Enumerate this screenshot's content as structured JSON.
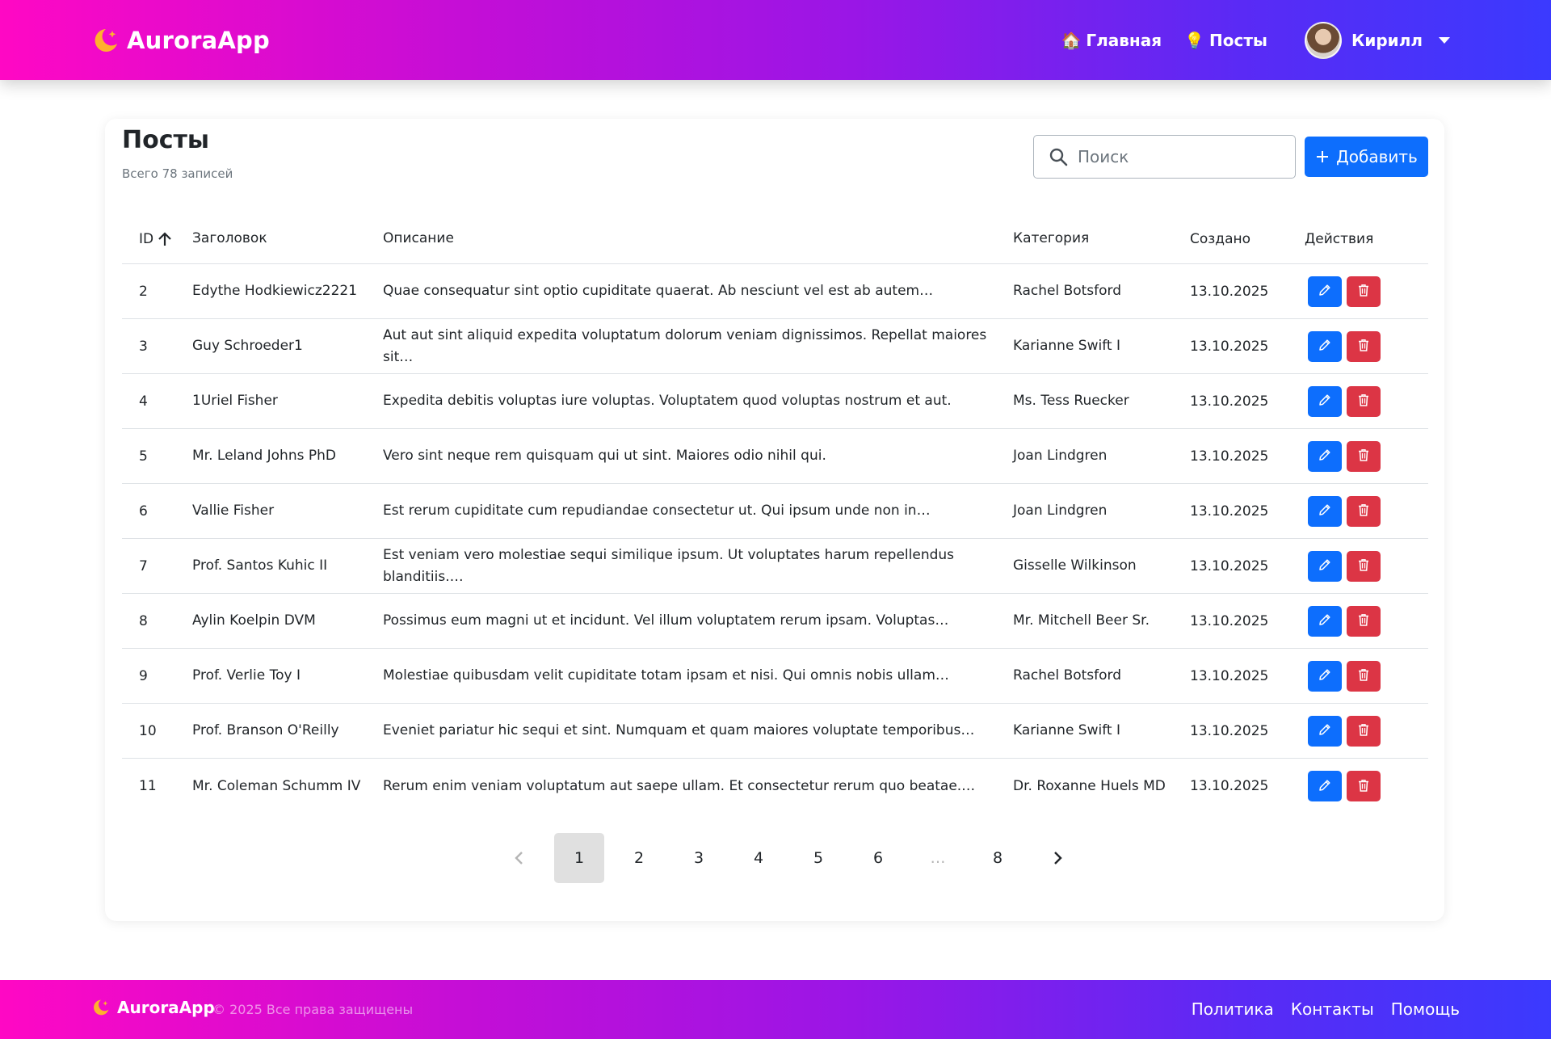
{
  "navbar": {
    "brand": "AuroraApp",
    "links": [
      {
        "emoji": "🏠",
        "label": "Главная"
      },
      {
        "emoji": "💡",
        "label": "Посты"
      }
    ],
    "user": {
      "name": "Кирилл"
    }
  },
  "page": {
    "title": "Посты",
    "subtitle": "Всего 78 записей",
    "search_placeholder": "Поиск",
    "add_label": "Добавить"
  },
  "table": {
    "headers": {
      "id": "ID",
      "title": "Заголовок",
      "description": "Описание",
      "category": "Категория",
      "created": "Создано",
      "actions": "Действия"
    },
    "rows": [
      {
        "id": "2",
        "title": "Edythe Hodkiewicz2221",
        "description": "Quae consequatur sint optio cupiditate quaerat. Ab nesciunt vel est ab autem…",
        "category": "Rachel Botsford",
        "created": "13.10.2025"
      },
      {
        "id": "3",
        "title": "Guy Schroeder1",
        "description": "Aut aut sint aliquid expedita voluptatum dolorum veniam dignissimos. Repellat maiores sit…",
        "category": "Karianne Swift I",
        "created": "13.10.2025"
      },
      {
        "id": "4",
        "title": "1Uriel Fisher",
        "description": "Expedita debitis voluptas iure voluptas. Voluptatem quod voluptas nostrum et aut.",
        "category": "Ms. Tess Ruecker",
        "created": "13.10.2025"
      },
      {
        "id": "5",
        "title": "Mr. Leland Johns PhD",
        "description": "Vero sint neque rem quisquam qui ut sint. Maiores odio nihil qui.",
        "category": "Joan Lindgren",
        "created": "13.10.2025"
      },
      {
        "id": "6",
        "title": "Vallie Fisher",
        "description": "Est rerum cupiditate cum repudiandae consectetur ut. Qui ipsum unde non in…",
        "category": "Joan Lindgren",
        "created": "13.10.2025"
      },
      {
        "id": "7",
        "title": "Prof. Santos Kuhic II",
        "description": "Est veniam vero molestiae sequi similique ipsum. Ut voluptates harum repellendus blanditiis.…",
        "category": "Gisselle Wilkinson",
        "created": "13.10.2025"
      },
      {
        "id": "8",
        "title": "Aylin Koelpin DVM",
        "description": "Possimus eum magni ut et incidunt. Vel illum voluptatem rerum ipsam. Voluptas…",
        "category": "Mr. Mitchell Beer Sr.",
        "created": "13.10.2025"
      },
      {
        "id": "9",
        "title": "Prof. Verlie Toy I",
        "description": "Molestiae quibusdam velit cupiditate totam ipsam et nisi. Qui omnis nobis ullam…",
        "category": "Rachel Botsford",
        "created": "13.10.2025"
      },
      {
        "id": "10",
        "title": "Prof. Branson O'Reilly",
        "description": "Eveniet pariatur hic sequi et sint. Numquam et quam maiores voluptate temporibus…",
        "category": "Karianne Swift I",
        "created": "13.10.2025"
      },
      {
        "id": "11",
        "title": "Mr. Coleman Schumm IV",
        "description": "Rerum enim veniam voluptatum aut saepe ullam. Et consectetur rerum quo beatae.…",
        "category": "Dr. Roxanne Huels MD",
        "created": "13.10.2025"
      }
    ]
  },
  "pagination": {
    "pages": [
      "1",
      "2",
      "3",
      "4",
      "5",
      "6",
      "…",
      "8"
    ],
    "active": "1"
  },
  "footer": {
    "brand": "AuroraApp",
    "copyright": "© 2025 Все права защищены",
    "links": [
      "Политика",
      "Контакты",
      "Помощь"
    ]
  },
  "colors": {
    "gradient_start": "#ff08c4",
    "gradient_end": "#3b3afe",
    "primary": "#0d6efd",
    "danger": "#dc3545",
    "moon": "#ffb02e"
  },
  "icons": {
    "brand": "moon-star-icon",
    "search": "search-icon",
    "add": "plus-icon",
    "sort": "arrow-up-icon",
    "edit": "pencil-icon",
    "delete": "trash-icon",
    "prev": "chevron-left-icon",
    "next": "chevron-right-icon",
    "user_menu": "caret-down-icon"
  }
}
